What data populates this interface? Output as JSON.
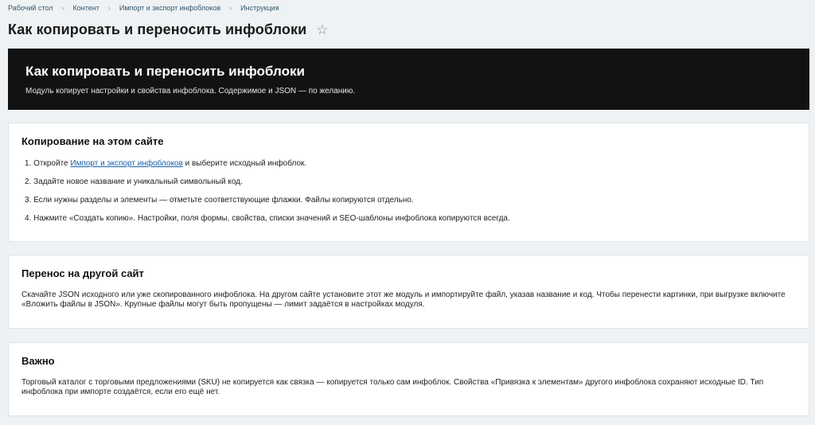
{
  "breadcrumb": [
    "Рабочий стол",
    "Контент",
    "Импорт и экспорт инфоблоков",
    "Инструкция"
  ],
  "page_title": "Как копировать и переносить инфоблоки",
  "hero": {
    "title": "Как копировать и переносить инфоблоки",
    "subtitle": "Модуль копирует настройки и свойства инфоблока. Содержимое и JSON — по желанию."
  },
  "copy_section": {
    "title": "Копирование на этом сайте",
    "step1_num": "1.",
    "step1_prefix": "Откройте",
    "step1_link": "Импорт и экспорт инфоблоков",
    "step1_suffix": "и выберите исходный инфоблок.",
    "step2": "2. Задайте новое название и уникальный символьный код.",
    "step3": "3. Если нужны разделы и элементы — отметьте соответствующие флажки. Файлы копируются отдельно.",
    "step4": "4. Нажмите «Создать копию». Настройки, поля формы, свойства, списки значений и SEO-шаблоны инфоблока копируются всегда."
  },
  "transfer_section": {
    "title": "Перенос на другой сайт",
    "text": "Скачайте JSON исходного или уже скопированного инфоблока. На другом сайте установите этот же модуль и импортируйте файл, указав название и код. Чтобы перенести картинки, при выгрузке включите «Вложить файлы в JSON». Крупные файлы могут быть пропущены — лимит задаётся в настройках модуля."
  },
  "important_section": {
    "title": "Важно",
    "text": "Торговый каталог с торговыми предложениями (SKU) не копируется как связка — копируется только сам инфоблок. Свойства «Привязка к элементам» другого инфоблока сохраняют исходные ID. Тип инфоблока при импорте создаётся, если его ещё нет."
  }
}
